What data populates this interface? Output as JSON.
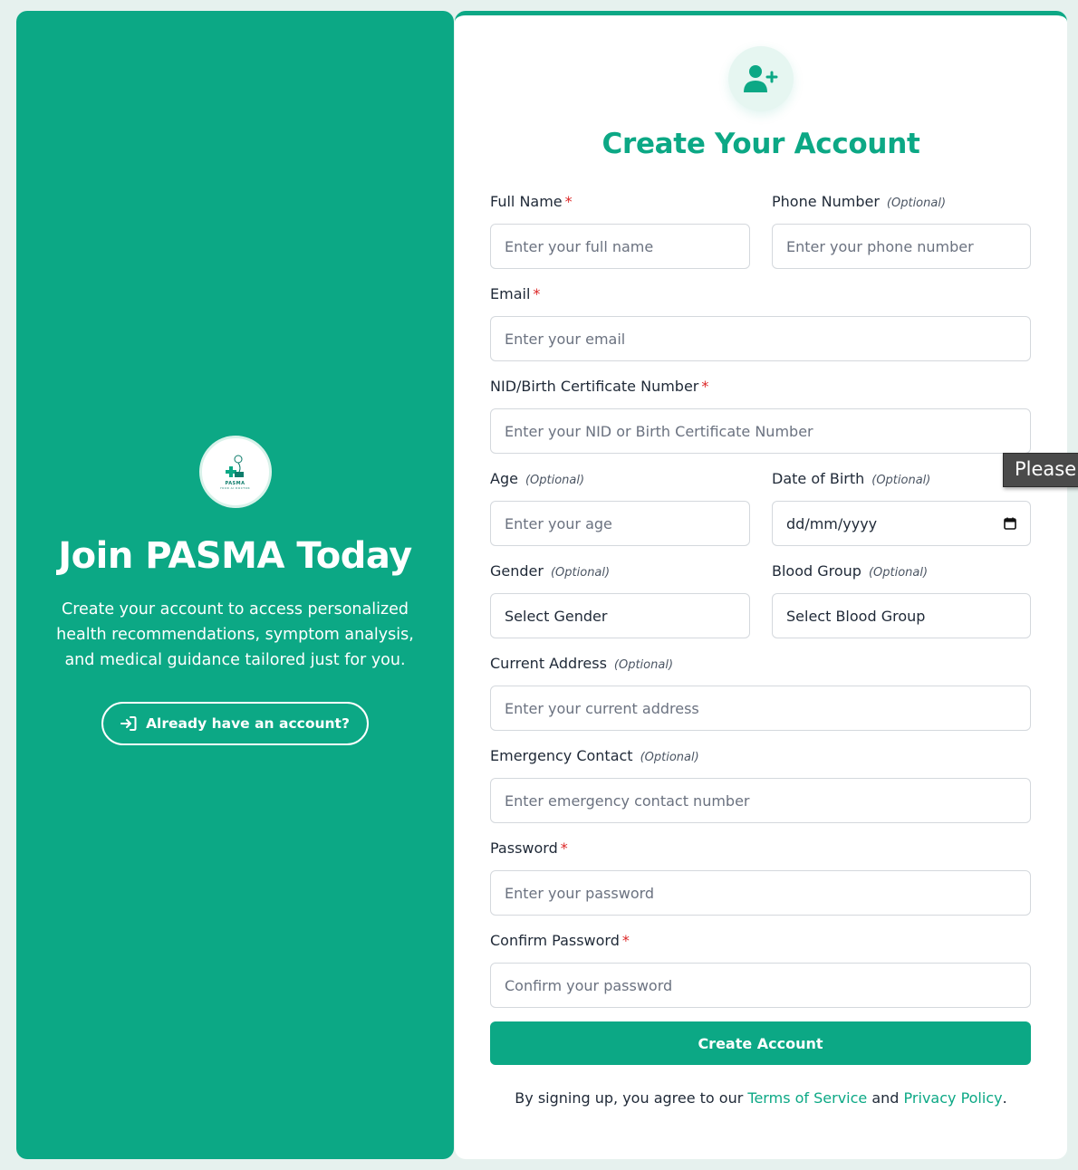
{
  "left": {
    "logo_text": "PASMA",
    "logo_subtext": "YOUR AI DOCTOR",
    "title": "Join PASMA Today",
    "description": "Create your account to access personalized health recommendations, symptom analysis, and medical guidance tailored just for you.",
    "login_button": "Already have an account?"
  },
  "form": {
    "title": "Create Your Account",
    "required_mark": "*",
    "optional_label": "(Optional)",
    "fields": {
      "full_name": {
        "label": "Full Name",
        "placeholder": "Enter your full name"
      },
      "phone": {
        "label": "Phone Number",
        "placeholder": "Enter your phone number"
      },
      "email": {
        "label": "Email",
        "placeholder": "Enter your email"
      },
      "nid": {
        "label": "NID/Birth Certificate Number",
        "placeholder": "Enter your NID or Birth Certificate Number"
      },
      "age": {
        "label": "Age",
        "placeholder": "Enter your age"
      },
      "dob": {
        "label": "Date of Birth",
        "value": "dd/mm/yyyy"
      },
      "gender": {
        "label": "Gender",
        "value": "Select Gender"
      },
      "blood_group": {
        "label": "Blood Group",
        "value": "Select Blood Group"
      },
      "address": {
        "label": "Current Address",
        "placeholder": "Enter your current address"
      },
      "emergency": {
        "label": "Emergency Contact",
        "placeholder": "Enter emergency contact number"
      },
      "password": {
        "label": "Password",
        "placeholder": "Enter your password"
      },
      "confirm": {
        "label": "Confirm Password",
        "placeholder": "Confirm your password"
      }
    },
    "submit": "Create Account",
    "terms": {
      "prefix": "By signing up, you agree to our",
      "tos": "Terms of Service",
      "and": "and",
      "privacy": "Privacy Policy",
      "suffix": "."
    }
  },
  "tooltip": "Please",
  "colors": {
    "brand": "#0ca885",
    "required": "#dc2626"
  }
}
